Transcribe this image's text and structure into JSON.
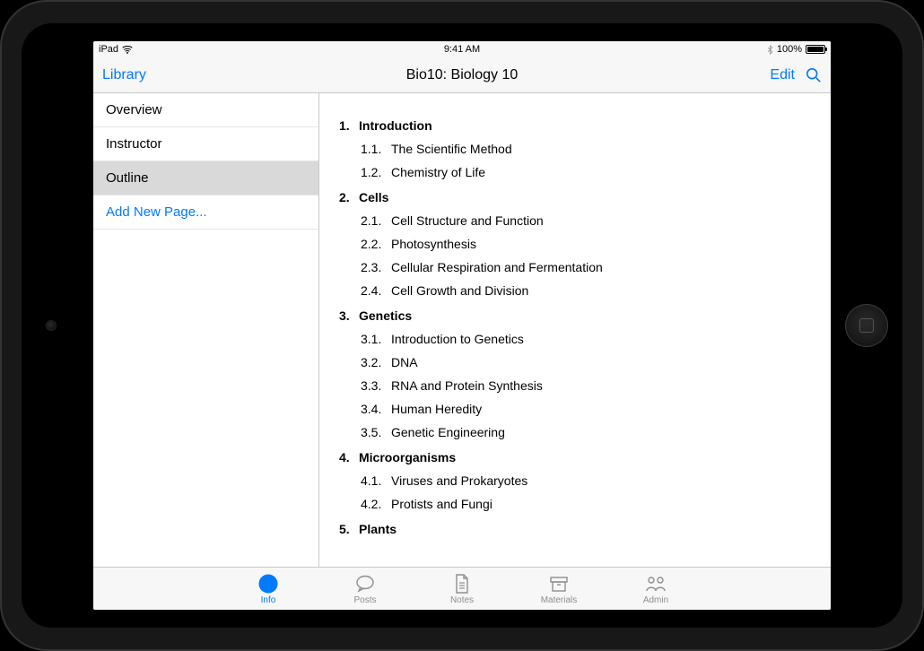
{
  "status_bar": {
    "device": "iPad",
    "time": "9:41 AM",
    "battery_pct": "100%"
  },
  "nav": {
    "back_label": "Library",
    "title": "Bio10: Biology 10",
    "edit_label": "Edit"
  },
  "sidebar": {
    "items": [
      {
        "label": "Overview",
        "selected": false,
        "link": false
      },
      {
        "label": "Instructor",
        "selected": false,
        "link": false
      },
      {
        "label": "Outline",
        "selected": true,
        "link": false
      },
      {
        "label": "Add New Page...",
        "selected": false,
        "link": true
      }
    ]
  },
  "outline": [
    {
      "num": "1.",
      "title": "Introduction",
      "children": [
        {
          "num": "1.1.",
          "title": "The Scientific Method"
        },
        {
          "num": "1.2.",
          "title": "Chemistry of Life"
        }
      ]
    },
    {
      "num": "2.",
      "title": "Cells",
      "children": [
        {
          "num": "2.1.",
          "title": "Cell Structure and Function"
        },
        {
          "num": "2.2.",
          "title": "Photosynthesis"
        },
        {
          "num": "2.3.",
          "title": "Cellular Respiration and Fermentation"
        },
        {
          "num": "2.4.",
          "title": "Cell Growth and Division"
        }
      ]
    },
    {
      "num": "3.",
      "title": "Genetics",
      "children": [
        {
          "num": "3.1.",
          "title": "Introduction to Genetics"
        },
        {
          "num": "3.2.",
          "title": "DNA"
        },
        {
          "num": "3.3.",
          "title": "RNA and Protein Synthesis"
        },
        {
          "num": "3.4.",
          "title": "Human Heredity"
        },
        {
          "num": "3.5.",
          "title": "Genetic Engineering"
        }
      ]
    },
    {
      "num": "4.",
      "title": "Microorganisms",
      "children": [
        {
          "num": "4.1.",
          "title": "Viruses and Prokaryotes"
        },
        {
          "num": "4.2.",
          "title": "Protists and Fungi"
        }
      ]
    },
    {
      "num": "5.",
      "title": "Plants",
      "children": []
    }
  ],
  "tabs": [
    {
      "label": "Info",
      "icon": "info-icon",
      "active": true
    },
    {
      "label": "Posts",
      "icon": "comment-icon",
      "active": false
    },
    {
      "label": "Notes",
      "icon": "document-icon",
      "active": false
    },
    {
      "label": "Materials",
      "icon": "archive-icon",
      "active": false
    },
    {
      "label": "Admin",
      "icon": "people-icon",
      "active": false
    }
  ]
}
